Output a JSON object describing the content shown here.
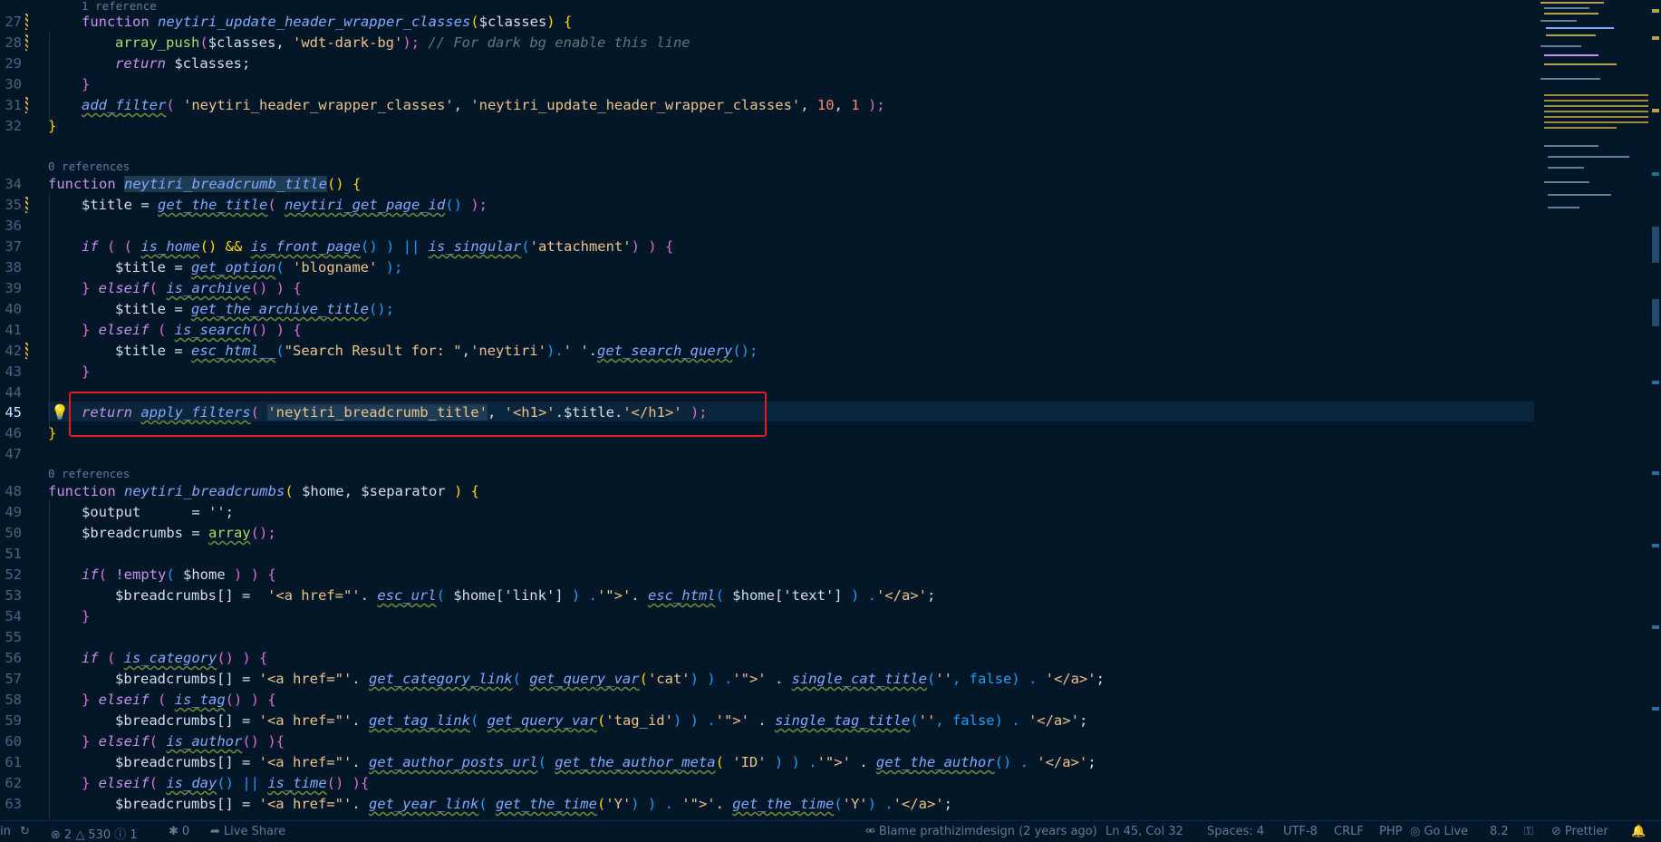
{
  "editor": {
    "lines": [
      {
        "n": "27",
        "mod": true
      },
      {
        "n": "28",
        "mod": true
      },
      {
        "n": "29",
        "mod": false
      },
      {
        "n": "30",
        "mod": false
      },
      {
        "n": "31",
        "mod": true
      },
      {
        "n": "32",
        "mod": false
      },
      {
        "n": "34",
        "mod": false
      },
      {
        "n": "35",
        "mod": true
      },
      {
        "n": "36",
        "mod": false
      },
      {
        "n": "37",
        "mod": false
      },
      {
        "n": "38",
        "mod": false
      },
      {
        "n": "39",
        "mod": false
      },
      {
        "n": "40",
        "mod": false
      },
      {
        "n": "41",
        "mod": false
      },
      {
        "n": "42",
        "mod": true
      },
      {
        "n": "43",
        "mod": false
      },
      {
        "n": "44",
        "mod": false
      },
      {
        "n": "45",
        "mod": false
      },
      {
        "n": "46",
        "mod": false
      },
      {
        "n": "47",
        "mod": false
      },
      {
        "n": "48",
        "mod": false
      },
      {
        "n": "49",
        "mod": false
      },
      {
        "n": "50",
        "mod": false
      },
      {
        "n": "51",
        "mod": false
      },
      {
        "n": "52",
        "mod": false
      },
      {
        "n": "53",
        "mod": false
      },
      {
        "n": "54",
        "mod": false
      },
      {
        "n": "55",
        "mod": false
      },
      {
        "n": "56",
        "mod": false
      },
      {
        "n": "57",
        "mod": false
      },
      {
        "n": "58",
        "mod": false
      },
      {
        "n": "59",
        "mod": false
      },
      {
        "n": "60",
        "mod": false
      },
      {
        "n": "61",
        "mod": false
      },
      {
        "n": "62",
        "mod": false
      },
      {
        "n": "63",
        "mod": false
      }
    ],
    "codelens": {
      "one_ref": "1 reference",
      "zero_refs_a": "0 references",
      "zero_refs_b": "0 references"
    },
    "code": {
      "l27": [
        "function ",
        "neytiri_update_header_wrapper_classes",
        "(",
        "$classes",
        ")",
        " {"
      ],
      "l28": [
        "array_push",
        "(",
        "$classes",
        ", ",
        "'wdt-dark-bg'",
        ");",
        " // For dark bg enable this line"
      ],
      "l29": [
        "return",
        " $classes;"
      ],
      "l30": [
        "}"
      ],
      "l31": [
        "add_filter",
        "( ",
        "'neytiri_header_wrapper_classes'",
        ", ",
        "'neytiri_update_header_wrapper_classes'",
        ", ",
        "10",
        ", ",
        "1",
        " );"
      ],
      "l32": [
        "}"
      ],
      "l34": [
        "function ",
        "neytiri_breadcrumb_title",
        "()",
        " {"
      ],
      "l35": [
        "$title = ",
        "get_the_title",
        "( ",
        "neytiri_get_page_id",
        "() ",
        ");"
      ],
      "l37": [
        "if",
        " ( ( ",
        "is_home",
        "() && ",
        "is_front_page",
        "() ) || ",
        "is_singular",
        "(",
        "'attachment'",
        ") ) {"
      ],
      "l38": [
        "$title = ",
        "get_option",
        "( ",
        "'blogname'",
        " );"
      ],
      "l39": [
        "} ",
        "elseif",
        "( ",
        "is_archive",
        "() ) {"
      ],
      "l40": [
        "$title = ",
        "get_the_archive_title",
        "();"
      ],
      "l41": [
        "} ",
        "elseif",
        " ( ",
        "is_search",
        "() ) {"
      ],
      "l42": [
        "$title = ",
        "esc_html__",
        "(",
        "\"Search Result for: \"",
        ",",
        "'neytiri'",
        ").",
        "' '",
        ".",
        "get_search_query",
        "();"
      ],
      "l43": [
        "}"
      ],
      "l45": [
        "return ",
        "apply_filters",
        "( ",
        "'neytiri_breadcrumb_title'",
        ", ",
        "'<h1>'",
        ".$title.",
        "'</h1>'",
        " );"
      ],
      "l46": [
        "}"
      ],
      "l48": [
        "function ",
        "neytiri_breadcrumbs",
        "( ",
        "$home, $separator",
        " ) {"
      ],
      "l49": [
        "$output      = ",
        "''",
        ";"
      ],
      "l50": [
        "$breadcrumbs = ",
        "array",
        "();"
      ],
      "l52": [
        "if",
        "( ",
        "!empty",
        "( ",
        "$home",
        " ) ) {"
      ],
      "l53": [
        "$breadcrumbs[] =  ",
        "'<a href=\"'",
        ". ",
        "esc_url",
        "( ",
        "$home['link']",
        " ) .",
        "'\">'",
        ". ",
        "esc_html",
        "( ",
        "$home['text']",
        " ) .",
        "'</a>'",
        ";"
      ],
      "l54": [
        "}"
      ],
      "l56": [
        "if",
        " ( ",
        "is_category",
        "() ) {"
      ],
      "l57": [
        "$breadcrumbs[] = ",
        "'<a href=\"'",
        ". ",
        "get_category_link",
        "( ",
        "get_query_var",
        "(",
        "'cat'",
        ") ) .",
        "'\">'",
        " . ",
        "single_cat_title",
        "(",
        "''",
        ", false) . ",
        "'</a>'",
        ";"
      ],
      "l58": [
        "} ",
        "elseif",
        " ( ",
        "is_tag",
        "() ) {"
      ],
      "l59": [
        "$breadcrumbs[] = ",
        "'<a href=\"'",
        ". ",
        "get_tag_link",
        "( ",
        "get_query_var",
        "(",
        "'tag_id'",
        ") ) .",
        "'\">'",
        " . ",
        "single_tag_title",
        "(",
        "''",
        ", false) . ",
        "'</a>'",
        ";"
      ],
      "l60": [
        "} ",
        "elseif",
        "( ",
        "is_author",
        "() ){"
      ],
      "l61": [
        "$breadcrumbs[] = ",
        "'<a href=\"'",
        ". ",
        "get_author_posts_url",
        "( ",
        "get_the_author_meta",
        "( ",
        "'ID'",
        " ) ) .",
        "'\">'",
        " . ",
        "get_the_author",
        "() . ",
        "'</a>'",
        ";"
      ],
      "l62": [
        "} ",
        "elseif",
        "( ",
        "is_day",
        "() || ",
        "is_time",
        "() ){"
      ],
      "l63": [
        "$breadcrumbs[] = ",
        "'<a href=\"'",
        ". ",
        "get_year_link",
        "( ",
        "get_the_time",
        "(",
        "'Y'",
        ") ) . ",
        "'\">'",
        ". ",
        "get_the_time",
        "(",
        "'Y'",
        ") .",
        "'</a>'",
        ";"
      ]
    }
  },
  "statusbar": {
    "left_partial": "in",
    "sync_icon": "sync-icon",
    "errors": "2",
    "warnings": "530",
    "infos": "1",
    "ports": "0",
    "live_share": "Live Share",
    "blame": "Blame prathizimdesign (2 years ago)",
    "cursor_pos": "Ln 45, Col 32",
    "spaces": "Spaces: 4",
    "encoding": "UTF-8",
    "eol": "CRLF",
    "language": "PHP",
    "go_live": "Go Live",
    "php_version": "8.2",
    "prettier": "Prettier"
  },
  "colors": {
    "background": "#011627",
    "highlight_box": "#e01b24",
    "modified_gutter": "#d9b640"
  }
}
